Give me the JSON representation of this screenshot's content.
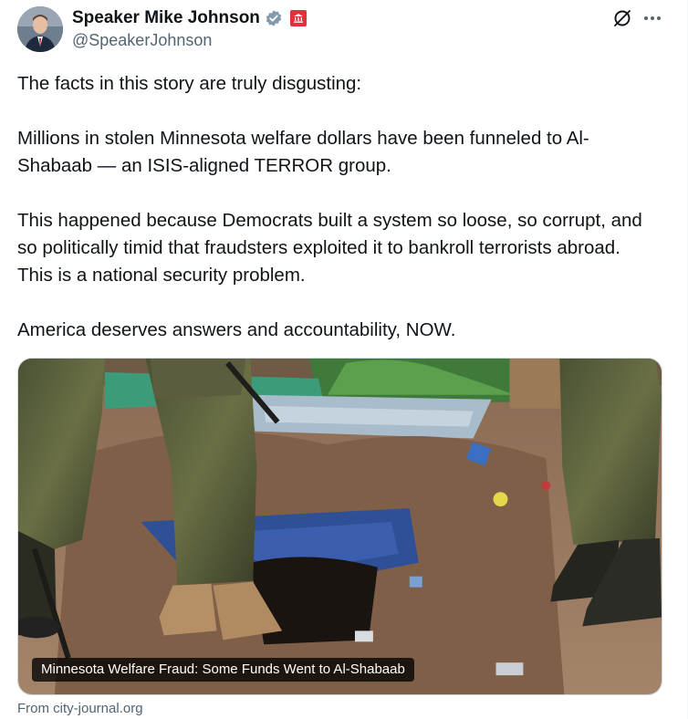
{
  "author": {
    "display_name": "Speaker Mike Johnson",
    "handle": "@SpeakerJohnson",
    "verified_badge_color": "#829aab",
    "affiliation_badge_color": "#e0323b"
  },
  "icons": {
    "avatar": "avatar",
    "verified": "verified-badge-icon",
    "affiliation": "government-affiliation-icon",
    "grok": "grok-icon",
    "more": "more-dots-icon"
  },
  "tweet": {
    "paragraphs": [
      "The facts in this story are truly disgusting:",
      "Millions in stolen Minnesota welfare dollars have been funneled to Al-Shabaab — an ISIS-aligned TERROR group.",
      "This happened because Democrats built a system so loose, so corrupt, and so politically timid that fraudsters exploited it to bankroll terrorists abroad. This is a national security problem.",
      "America deserves answers and accountability, NOW."
    ]
  },
  "card": {
    "caption": "Minnesota Welfare Fraud: Some Funds Went to Al-Shabaab",
    "source": "From city-journal.org"
  },
  "colors": {
    "text_primary": "#0f1419",
    "text_secondary": "#536471",
    "border": "#cfd9de"
  }
}
